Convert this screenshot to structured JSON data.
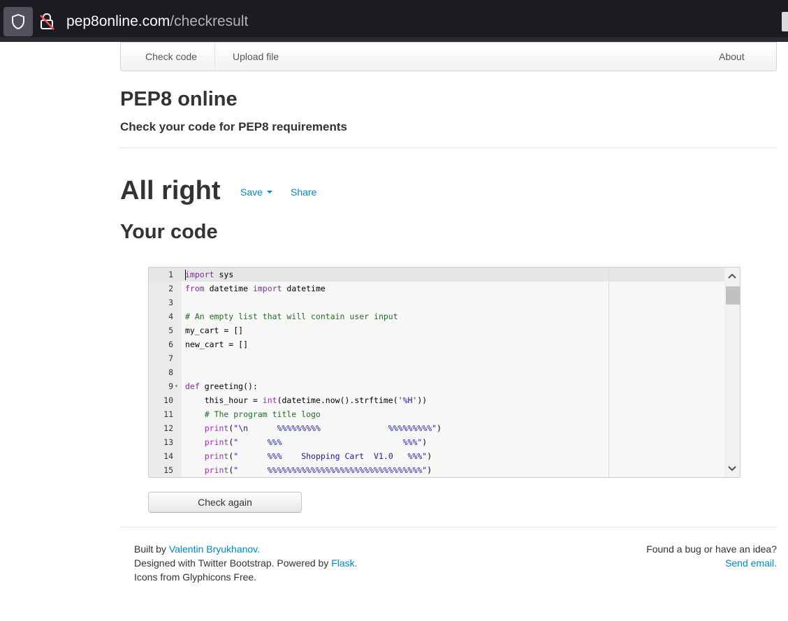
{
  "browser": {
    "url_host": "pep8online.com",
    "url_path": "/checkresult"
  },
  "nav": {
    "check_code": "Check code",
    "upload_file": "Upload file",
    "about": "About"
  },
  "header": {
    "title": "PEP8 online",
    "subtitle": "Check your code for PEP8 requirements"
  },
  "result": {
    "status": "All right",
    "save": "Save",
    "share": "Share"
  },
  "code_section": {
    "title": "Your code",
    "lines": [
      {
        "n": "1",
        "text": "import sys"
      },
      {
        "n": "2",
        "text": "from datetime import datetime"
      },
      {
        "n": "3",
        "text": ""
      },
      {
        "n": "4",
        "text": "# An empty list that will contain user input"
      },
      {
        "n": "5",
        "text": "my_cart = []"
      },
      {
        "n": "6",
        "text": "new_cart = []"
      },
      {
        "n": "7",
        "text": ""
      },
      {
        "n": "8",
        "text": ""
      },
      {
        "n": "9",
        "text": "def greeting():"
      },
      {
        "n": "10",
        "text": "    this_hour = int(datetime.now().strftime('%H'))"
      },
      {
        "n": "11",
        "text": "    # The program title logo"
      },
      {
        "n": "12",
        "text": "    print(\"\\n      %%%%%%%%%              %%%%%%%%%\")"
      },
      {
        "n": "13",
        "text": "    print(\"      %%%                         %%%\")"
      },
      {
        "n": "14",
        "text": "    print(\"      %%%    Shopping Cart  V1.0   %%%\")"
      },
      {
        "n": "15",
        "text": "    print(\"      %%%%%%%%%%%%%%%%%%%%%%%%%%%%%%%%\")"
      }
    ]
  },
  "actions": {
    "check_again": "Check again"
  },
  "footer": {
    "built_by_prefix": "Built by ",
    "built_by_link": "Valentin Bryukhanov.",
    "designed_prefix": "Designed with Twitter Bootstrap. Powered by ",
    "designed_link": "Flask.",
    "icons_text": "Icons from Glyphicons Free.",
    "bug_text": "Found a bug or have an idea?",
    "send_email": "Send email."
  },
  "colors": {
    "link": "#0088cc",
    "browser_bg": "#1c1b22"
  }
}
